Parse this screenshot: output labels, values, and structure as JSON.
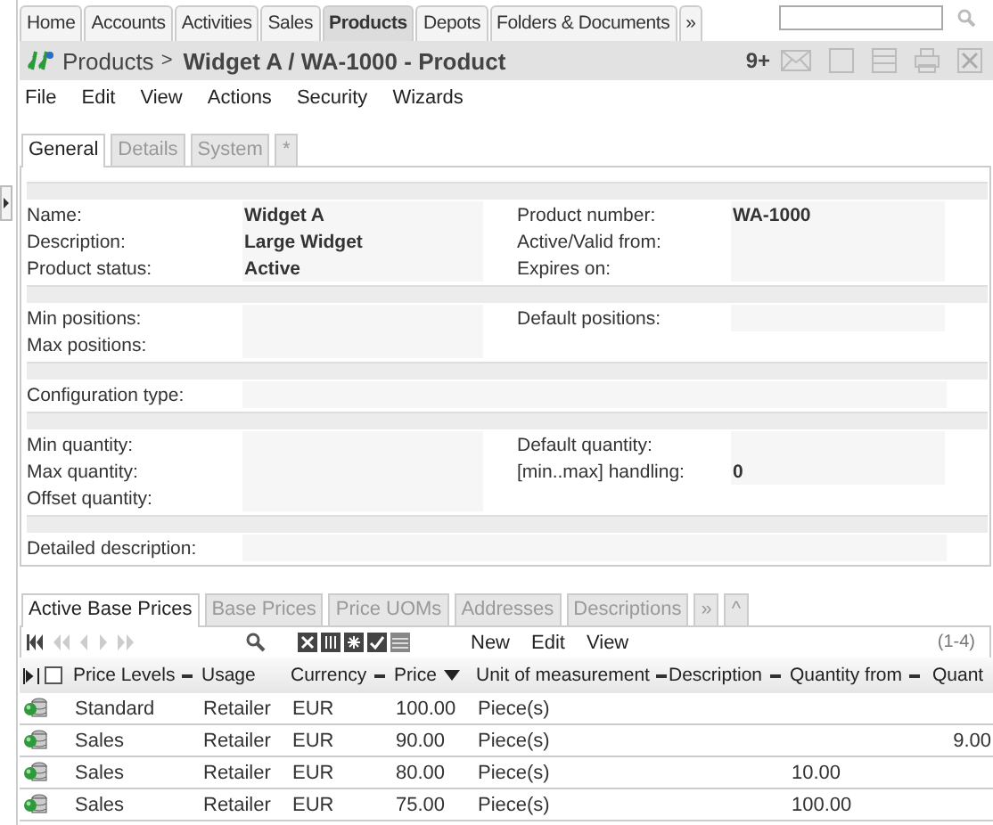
{
  "nav_tabs": [
    {
      "label": "Home",
      "selected": false
    },
    {
      "label": "Accounts",
      "selected": false
    },
    {
      "label": "Activities",
      "selected": false
    },
    {
      "label": "Sales",
      "selected": false
    },
    {
      "label": "Products",
      "selected": true
    },
    {
      "label": "Depots",
      "selected": false
    },
    {
      "label": "Folders & Documents",
      "selected": false
    },
    {
      "label": "»",
      "selected": false
    }
  ],
  "header": {
    "breadcrumb": "Products",
    "separator": ">",
    "title": "Widget A / WA-1000 - Product",
    "count": "9+"
  },
  "menu": [
    "File",
    "Edit",
    "View",
    "Actions",
    "Security",
    "Wizards"
  ],
  "form_tabs": [
    {
      "label": "General",
      "selected": true
    },
    {
      "label": "Details",
      "selected": false
    },
    {
      "label": "System",
      "selected": false
    },
    {
      "label": "*",
      "selected": false
    }
  ],
  "sections": [
    {
      "rows": [
        {
          "kind": "pair",
          "left": {
            "label": "Name:",
            "value": "Widget A"
          },
          "right": {
            "label": "Product number:",
            "value": "WA-1000"
          }
        },
        {
          "kind": "pair",
          "left": {
            "label": "Description:",
            "value": "Large Widget"
          },
          "right": {
            "label": "Active/Valid from:"
          }
        },
        {
          "kind": "pair",
          "left": {
            "label": "Product status:",
            "value": "Active"
          },
          "right": {
            "label": "Expires on:"
          }
        }
      ]
    },
    {
      "rows": [
        {
          "kind": "pair",
          "left": {
            "label": "Min positions:"
          },
          "right": {
            "label": "Default positions:"
          }
        },
        {
          "kind": "pair",
          "left": {
            "label": "Max positions:"
          }
        }
      ]
    },
    {
      "rows": [
        {
          "kind": "wide",
          "left": {
            "label": "Configuration type:"
          }
        }
      ]
    },
    {
      "rows": [
        {
          "kind": "pair",
          "left": {
            "label": "Min quantity:"
          },
          "right": {
            "label": "Default quantity:"
          }
        },
        {
          "kind": "pair",
          "left": {
            "label": "Max quantity:"
          },
          "right": {
            "label": "[min..max] handling:",
            "value": "0"
          }
        },
        {
          "kind": "pair",
          "left": {
            "label": "Offset quantity:"
          }
        }
      ]
    },
    {
      "rows": [
        {
          "kind": "wide",
          "left": {
            "label": "Detailed description:"
          }
        }
      ]
    }
  ],
  "detail_tabs": [
    {
      "label": "Active Base Prices",
      "selected": true
    },
    {
      "label": "Base Prices",
      "selected": false
    },
    {
      "label": "Price UOMs",
      "selected": false
    },
    {
      "label": "Addresses",
      "selected": false
    },
    {
      "label": "Descriptions",
      "selected": false
    },
    {
      "label": "»",
      "selected": false
    },
    {
      "label": "^",
      "selected": false
    }
  ],
  "grid_toolbar": {
    "actions": [
      "New",
      "Edit",
      "View"
    ],
    "range": "(1-4)"
  },
  "select_all": {
    "checked": false
  },
  "columns": [
    {
      "label": "Price Levels",
      "menu": true,
      "sorted": false
    },
    {
      "label": "Usage",
      "menu": false,
      "sorted": false
    },
    {
      "label": "Currency",
      "menu": true,
      "sorted": false
    },
    {
      "label": "Price",
      "menu": false,
      "sorted": true
    },
    {
      "label": "Unit of measurement",
      "menu": true,
      "sorted": false
    },
    {
      "label": "Description",
      "menu": true,
      "sorted": false
    },
    {
      "label": "Quantity from",
      "menu": true,
      "sorted": false
    },
    {
      "label": "Quant",
      "menu": false,
      "sorted": false
    }
  ],
  "rows": [
    {
      "price_level": "Standard",
      "usage": "Retailer",
      "currency": "EUR",
      "price": "100.00",
      "unit": "Piece(s)"
    },
    {
      "price_level": "Sales",
      "usage": "Retailer",
      "currency": "EUR",
      "price": "90.00",
      "unit": "Piece(s)",
      "column_8": "9.00"
    },
    {
      "price_level": "Sales",
      "usage": "Retailer",
      "currency": "EUR",
      "price": "80.00",
      "unit": "Piece(s)",
      "quantity_from": "10.00"
    },
    {
      "price_level": "Sales",
      "usage": "Retailer",
      "currency": "EUR",
      "price": "75.00",
      "unit": "Piece(s)",
      "quantity_from": "100.00"
    }
  ]
}
